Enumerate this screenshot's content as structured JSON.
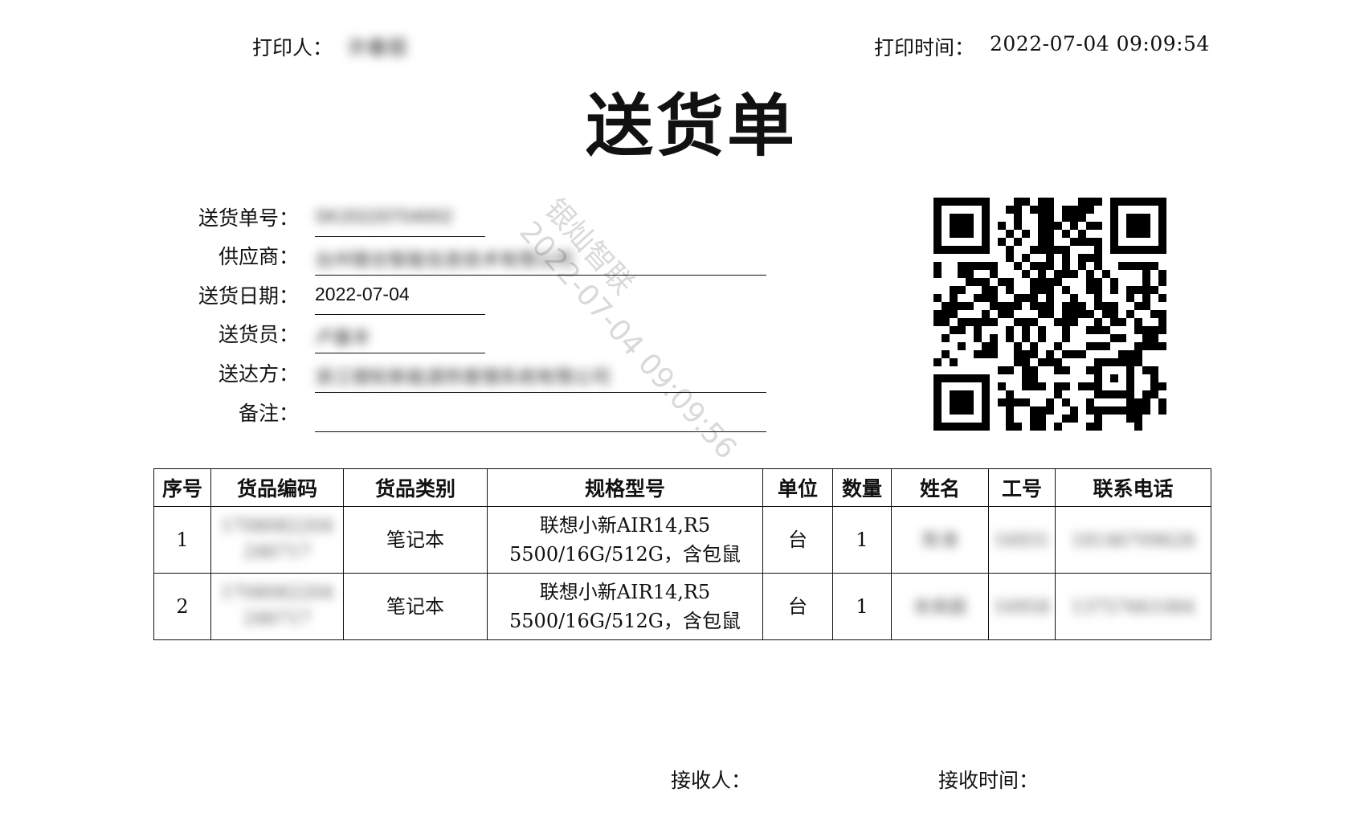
{
  "header": {
    "printed_by_label": "打印人：",
    "printed_by_value": "许春丽",
    "print_time_label": "打印时间：",
    "print_time_value": "2022-07-04 09:09:54"
  },
  "title": "送货单",
  "watermark": "银灿智联\n2022-07-04 09:09:56",
  "info": {
    "order_no_label": "送货单号：",
    "order_no_value": "SK20220704002",
    "supplier_label": "供应商：",
    "supplier_value": "台州银合智能信息技术有限公司",
    "date_label": "送货日期：",
    "date_value": "2022-07-04",
    "courier_label": "送货员：",
    "courier_value": "卢基丰",
    "recipient_label": "送达方：",
    "recipient_value": "浙江银轮新能源热管理系统有限公司",
    "remark_label": "备注：",
    "remark_value": ""
  },
  "table": {
    "headers": [
      "序号",
      "货品编码",
      "货品类别",
      "规格型号",
      "单位",
      "数量",
      "姓名",
      "工号",
      "联系电话"
    ],
    "rows": [
      {
        "no": "1",
        "code": "1708082204246717",
        "category": "笔记本",
        "spec_line1": "联想小新AIR14,R5",
        "spec_line2": "5500/16G/512G，含包鼠",
        "unit": "台",
        "qty": "1",
        "name": "陈涛",
        "emp_id": "16931",
        "phone": "18146709628"
      },
      {
        "no": "2",
        "code": "1708082204246717",
        "category": "笔记本",
        "spec_line1": "联想小新AIR14,R5",
        "spec_line2": "5500/16G/512G，含包鼠",
        "unit": "台",
        "qty": "1",
        "name": "余其超",
        "emp_id": "16958",
        "phone": "13757661084"
      }
    ]
  },
  "footer": {
    "receiver_label": "接收人：",
    "receive_time_label": "接收时间："
  }
}
